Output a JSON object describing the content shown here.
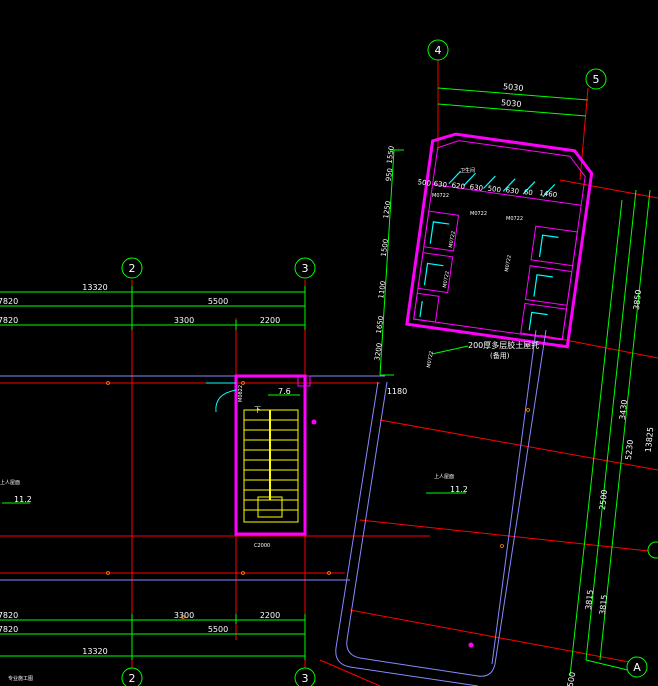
{
  "colors": {
    "background": "#000000",
    "grid_axis": "#ff0000",
    "dimension": "#00ff00",
    "wall": "#ff00ff",
    "outline": "#ffffff",
    "door": "#00ffff",
    "stair": "#ffff00",
    "bubble": "#00ff00",
    "label": "#ffffff",
    "beam": "#8888ff"
  },
  "axes": {
    "axis_2_top": "2",
    "axis_3_top": "3",
    "axis_2_bottom": "2",
    "axis_3_bottom": "3",
    "axis_4": "4",
    "axis_5": "5",
    "axis_A": "A"
  },
  "dims_left_top": {
    "total": "13320",
    "part_a": "7820",
    "part_b": "5500",
    "part_c": "7820",
    "part_d": "3300",
    "part_e": "2200"
  },
  "dims_left_bottom": {
    "part_a": "7820",
    "part_d": "3300",
    "part_e": "2200",
    "part_c": "7820",
    "part_b": "5500",
    "total": "13320"
  },
  "dims_tower_top": {
    "outer": "5030",
    "inner": "5030"
  },
  "dims_tower_row": [
    "500",
    "630",
    "620",
    "630",
    "500",
    "630",
    "60",
    "1460"
  ],
  "dims_tower_left": [
    "1550",
    "950",
    "1250",
    "1500",
    "1100",
    "1650",
    "3200"
  ],
  "dims_tower_bottom": "1180",
  "dims_right": [
    "3850",
    "3430",
    "5230",
    "2500",
    "3815",
    "13825",
    "3815"
  ],
  "dims_bottom_right": "500",
  "labels": {
    "elev_stair": "7.6",
    "elev_left": "11.2",
    "elev_mid": "11.2",
    "stair_down": "下",
    "note_slab": "200厚多层胶土屋托",
    "note_slab2": "(备用)",
    "door_m0722_a": "M0722",
    "door_m0722_b": "M0722",
    "door_m0722_c": "M0722",
    "door_m0722_d": "M0722",
    "door_m0722_e": "M0722",
    "door_m0722_f": "M0722",
    "door_m0722_g": "M0722",
    "door_m0822": "M0822",
    "room_top": "卫生间",
    "room_mid": "上人屋面",
    "room_left": "上人屋面",
    "stair_note": "C2000",
    "bottom_note": "专业施工图"
  }
}
